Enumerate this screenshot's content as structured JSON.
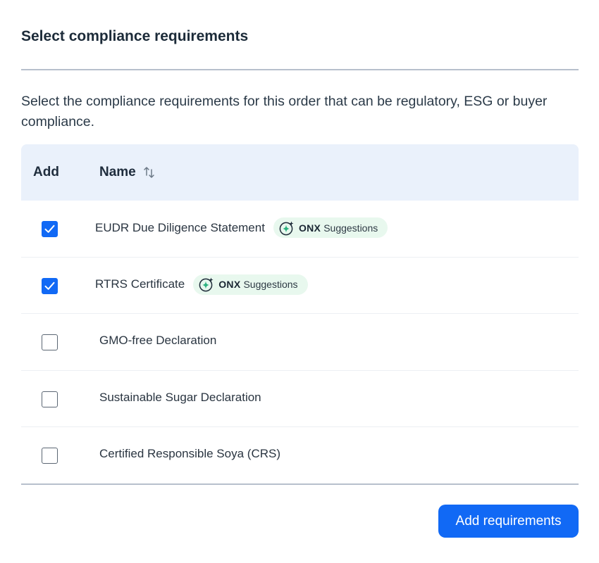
{
  "dialog": {
    "title": "Select compliance requirements",
    "description": "Select the compliance requirements for this order that can be regulatory, ESG or buyer compliance."
  },
  "table": {
    "headers": {
      "add": "Add",
      "name": "Name"
    },
    "sort_icon": "sort-arrows-icon",
    "rows": [
      {
        "name": "EUDR Due Diligence Statement",
        "checked": true,
        "suggested": true
      },
      {
        "name": "RTRS Certificate",
        "checked": true,
        "suggested": true
      },
      {
        "name": "GMO-free Declaration",
        "checked": false,
        "suggested": false
      },
      {
        "name": "Sustainable Sugar Declaration",
        "checked": false,
        "suggested": false
      },
      {
        "name": "Certified Responsible Soya (CRS)",
        "checked": false,
        "suggested": false
      }
    ]
  },
  "badge": {
    "brand": "ONX",
    "label": "Suggestions",
    "icon": "sparkle-icon"
  },
  "actions": {
    "submit_label": "Add requirements"
  },
  "colors": {
    "accent": "#1169f5",
    "header_bg": "#eaf1fb",
    "badge_bg": "#e8f8ee",
    "badge_icon": "#2bb37f"
  }
}
